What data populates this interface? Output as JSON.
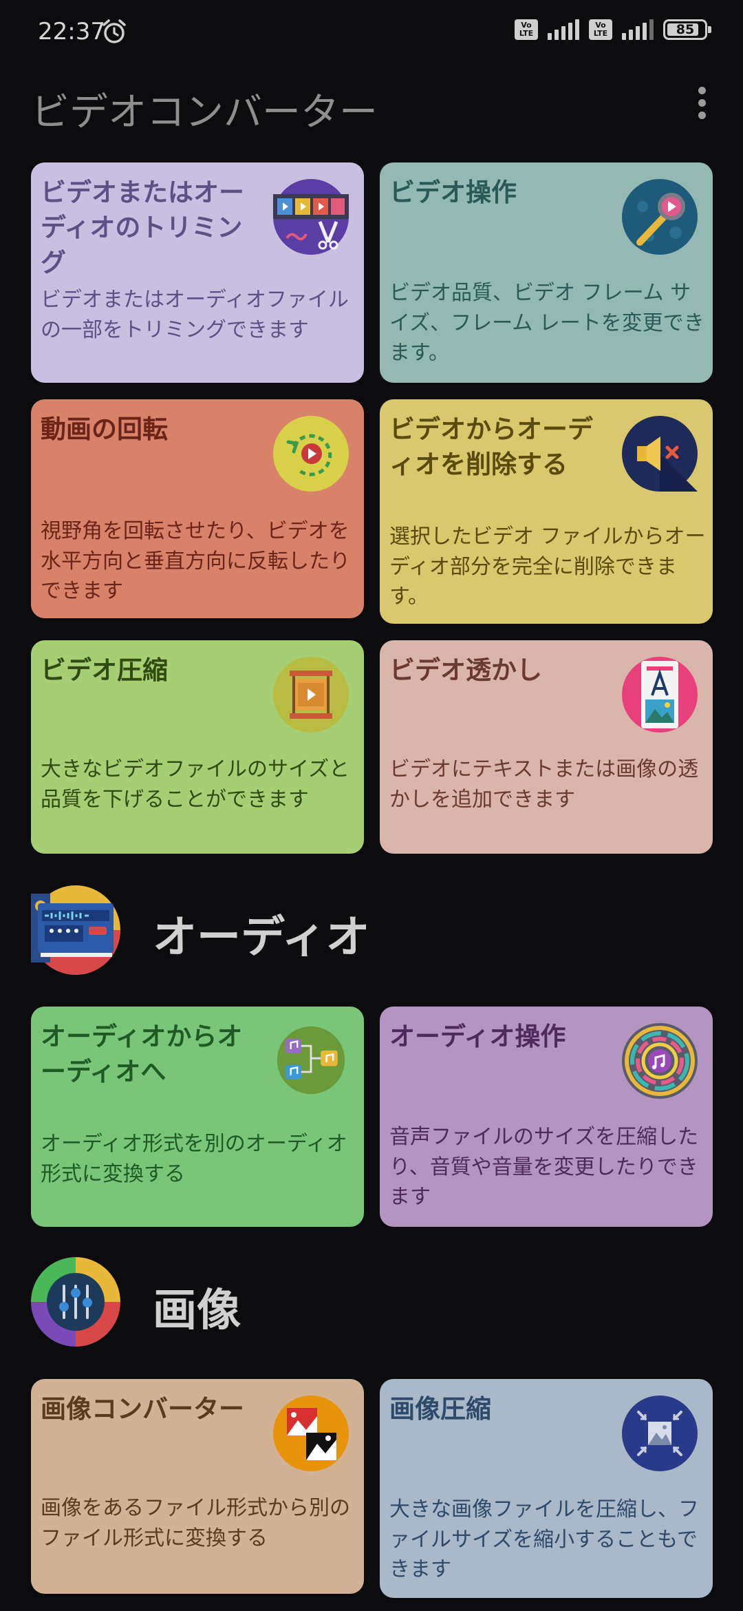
{
  "status": {
    "time": "22:37",
    "battery": "85",
    "volte1": "Vo LTE",
    "volte2": "Vo LTE"
  },
  "app": {
    "title": "ビデオコンバーター"
  },
  "video_cards": [
    {
      "title": "ビデオまたはオーディオのトリミング",
      "desc": "ビデオまたはオーディオファイルの一部をトリミングできます",
      "icon": "film-scissors-icon"
    },
    {
      "title": "ビデオ操作",
      "desc": "ビデオ品質、ビデオ フレーム サイズ、フレーム レートを変更できます。",
      "icon": "video-tool-icon"
    },
    {
      "title": "動画の回転",
      "desc": "視野角を回転させたり、ビデオを水平方向と垂直方向に反転したりできます",
      "icon": "rotate-video-icon"
    },
    {
      "title": "ビデオからオーディオを削除する",
      "desc": "選択したビデオ ファイルからオーディオ部分を完全に削除できます。",
      "icon": "mute-speaker-icon"
    },
    {
      "title": "ビデオ圧縮",
      "desc": "大きなビデオファイルのサイズと品質を下げることができます",
      "icon": "video-compress-icon"
    },
    {
      "title": "ビデオ透かし",
      "desc": "ビデオにテキストまたは画像の透かしを追加できます",
      "icon": "watermark-document-icon"
    }
  ],
  "audio_section": {
    "title": "オーディオ",
    "icon": "audio-panel-icon"
  },
  "audio_cards": [
    {
      "title": "オーディオからオーディオへ",
      "desc": "オーディオ形式を別のオーディオ形式に変換する",
      "icon": "music-convert-icon"
    },
    {
      "title": "オーディオ操作",
      "desc": "音声ファイルのサイズを圧縮したり、音質や音量を変更したりできます",
      "icon": "music-disc-icon"
    }
  ],
  "image_section": {
    "title": "画像",
    "icon": "equalizer-icon"
  },
  "image_cards": [
    {
      "title": "画像コンバーター",
      "desc": "画像をあるファイル形式から別のファイル形式に変換する",
      "icon": "image-convert-icon"
    },
    {
      "title": "画像圧縮",
      "desc": "大きな画像ファイルを圧縮し、ファイルサイズを縮小することもできます",
      "icon": "image-compress-icon"
    }
  ],
  "colors": {
    "trim_card": "#c9c0e1",
    "trim_text": "#5c5184",
    "manip_card": "#94b9b3",
    "manip_text": "#2a5a56",
    "rotate_card": "#d9826a",
    "rotate_text": "#6b2418",
    "remove_card": "#d9c86e",
    "remove_text": "#5a4a0e",
    "compress_card": "#a6cf73",
    "compress_text": "#304a12",
    "watermark_card": "#d9b5ac",
    "watermark_text": "#6a3a30",
    "a2a_card": "#79c679",
    "a2a_text": "#1f5a24",
    "audioop_card": "#b494c0",
    "audioop_text": "#4e2a5c",
    "imgconv_card": "#d2b295",
    "imgconv_text": "#5a3a20",
    "imgcomp_card": "#a9b9c9",
    "imgcomp_text": "#2e4a6a"
  }
}
